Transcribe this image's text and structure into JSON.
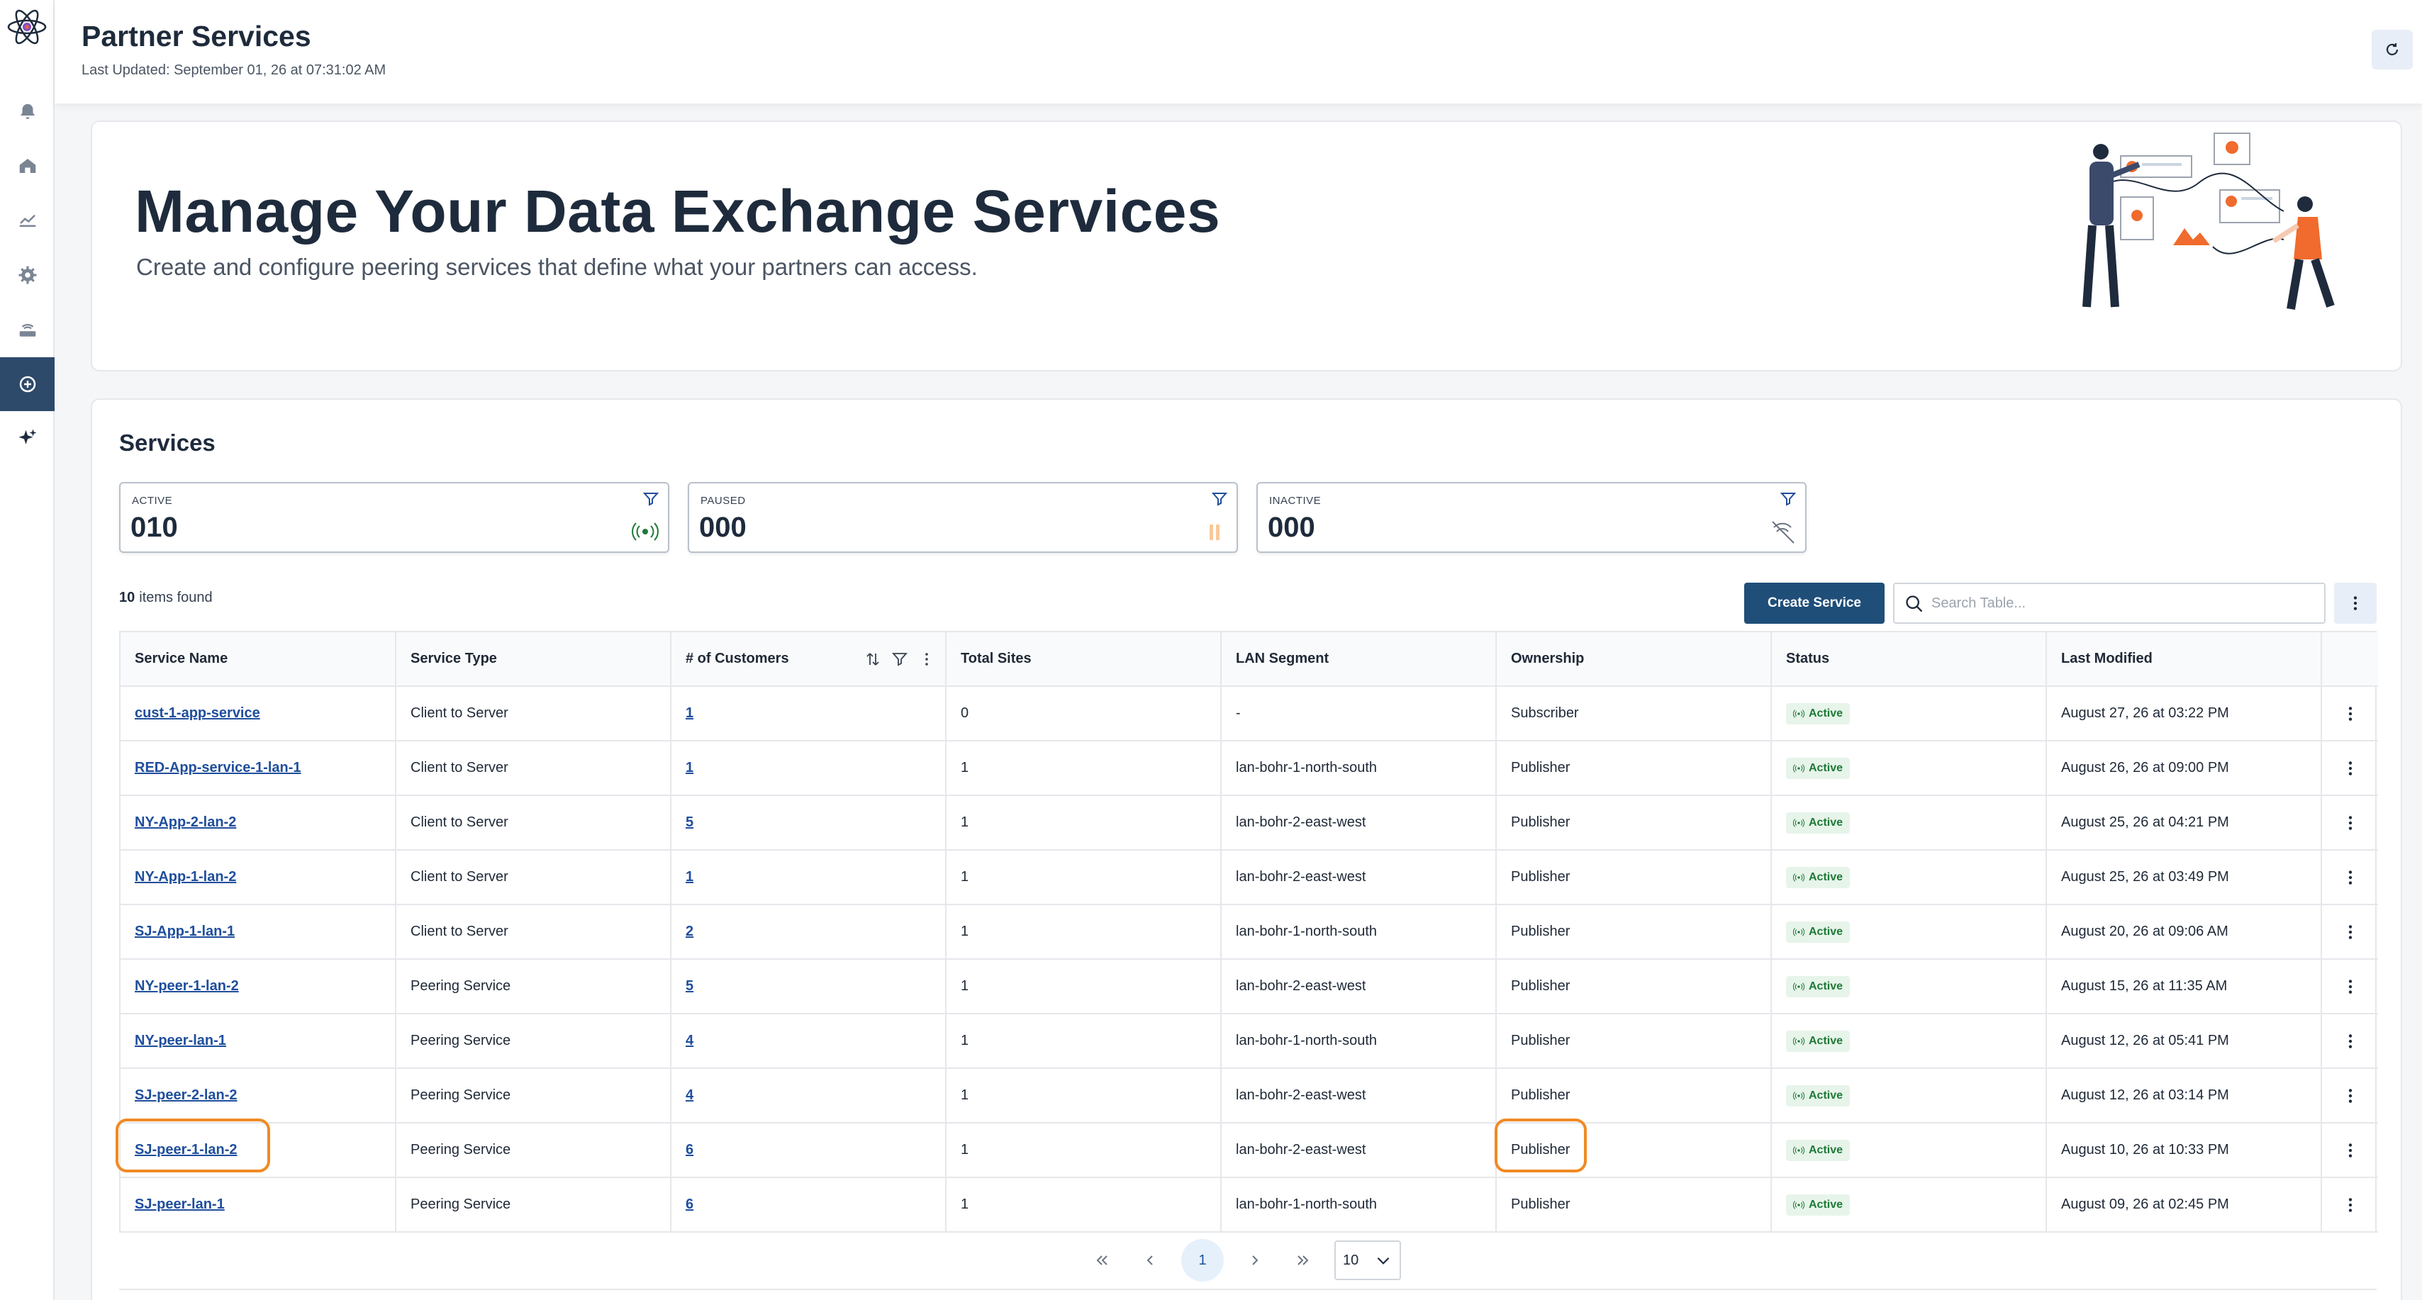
{
  "header": {
    "title": "Partner Services",
    "last_updated": "Last Updated: September 01, 26 at 07:31:02 AM"
  },
  "sidebar": {
    "items": [
      {
        "icon": "bell-icon"
      },
      {
        "icon": "home-icon"
      },
      {
        "icon": "chart-icon"
      },
      {
        "icon": "gear-icon"
      },
      {
        "icon": "router-icon"
      },
      {
        "icon": "partner-services-icon",
        "active": true
      },
      {
        "icon": "sparkle-icon"
      }
    ]
  },
  "hero": {
    "title": "Manage Your Data Exchange Services",
    "subtitle": "Create and configure peering services that define what your partners can access."
  },
  "services": {
    "title": "Services",
    "stats": [
      {
        "label": "ACTIVE",
        "value": "010"
      },
      {
        "label": "PAUSED",
        "value": "000"
      },
      {
        "label": "INACTIVE",
        "value": "000"
      }
    ],
    "items_count": "10",
    "items_label": "items found",
    "create_label": "Create Service",
    "search_placeholder": "Search Table..."
  },
  "table": {
    "columns": [
      "Service Name",
      "Service Type",
      "# of Customers",
      "Total Sites",
      "LAN Segment",
      "Ownership",
      "Status",
      "Last Modified"
    ],
    "rows": [
      {
        "name": "cust-1-app-service",
        "type": "Client to Server",
        "customers": "1",
        "sites": "0",
        "lan": "-",
        "ownership": "Subscriber",
        "status": "Active",
        "modified": "August 27, 26 at 03:22 PM"
      },
      {
        "name": "RED-App-service-1-lan-1",
        "type": "Client to Server",
        "customers": "1",
        "sites": "1",
        "lan": "lan-bohr-1-north-south",
        "ownership": "Publisher",
        "status": "Active",
        "modified": "August 26, 26 at 09:00 PM"
      },
      {
        "name": "NY-App-2-lan-2",
        "type": "Client to Server",
        "customers": "5",
        "sites": "1",
        "lan": "lan-bohr-2-east-west",
        "ownership": "Publisher",
        "status": "Active",
        "modified": "August 25, 26 at 04:21 PM"
      },
      {
        "name": "NY-App-1-lan-2",
        "type": "Client to Server",
        "customers": "1",
        "sites": "1",
        "lan": "lan-bohr-2-east-west",
        "ownership": "Publisher",
        "status": "Active",
        "modified": "August 25, 26 at 03:49 PM"
      },
      {
        "name": "SJ-App-1-lan-1",
        "type": "Client to Server",
        "customers": "2",
        "sites": "1",
        "lan": "lan-bohr-1-north-south",
        "ownership": "Publisher",
        "status": "Active",
        "modified": "August 20, 26 at 09:06 AM"
      },
      {
        "name": "NY-peer-1-lan-2",
        "type": "Peering Service",
        "customers": "5",
        "sites": "1",
        "lan": "lan-bohr-2-east-west",
        "ownership": "Publisher",
        "status": "Active",
        "modified": "August 15, 26 at 11:35 AM"
      },
      {
        "name": "NY-peer-lan-1",
        "type": "Peering Service",
        "customers": "4",
        "sites": "1",
        "lan": "lan-bohr-1-north-south",
        "ownership": "Publisher",
        "status": "Active",
        "modified": "August 12, 26 at 05:41 PM"
      },
      {
        "name": "SJ-peer-2-lan-2",
        "type": "Peering Service",
        "customers": "4",
        "sites": "1",
        "lan": "lan-bohr-2-east-west",
        "ownership": "Publisher",
        "status": "Active",
        "modified": "August 12, 26 at 03:14 PM"
      },
      {
        "name": "SJ-peer-1-lan-2",
        "type": "Peering Service",
        "customers": "6",
        "sites": "1",
        "lan": "lan-bohr-2-east-west",
        "ownership": "Publisher",
        "status": "Active",
        "modified": "August 10, 26 at 10:33 PM"
      },
      {
        "name": "SJ-peer-lan-1",
        "type": "Peering Service",
        "customers": "6",
        "sites": "1",
        "lan": "lan-bohr-1-north-south",
        "ownership": "Publisher",
        "status": "Active",
        "modified": "August 09, 26 at 02:45 PM"
      }
    ]
  },
  "pagination": {
    "current_page": "1",
    "page_size": "10"
  },
  "colors": {
    "primary": "#1f4e79",
    "highlight": "#f08a24",
    "active_green": "#1d7a36"
  }
}
